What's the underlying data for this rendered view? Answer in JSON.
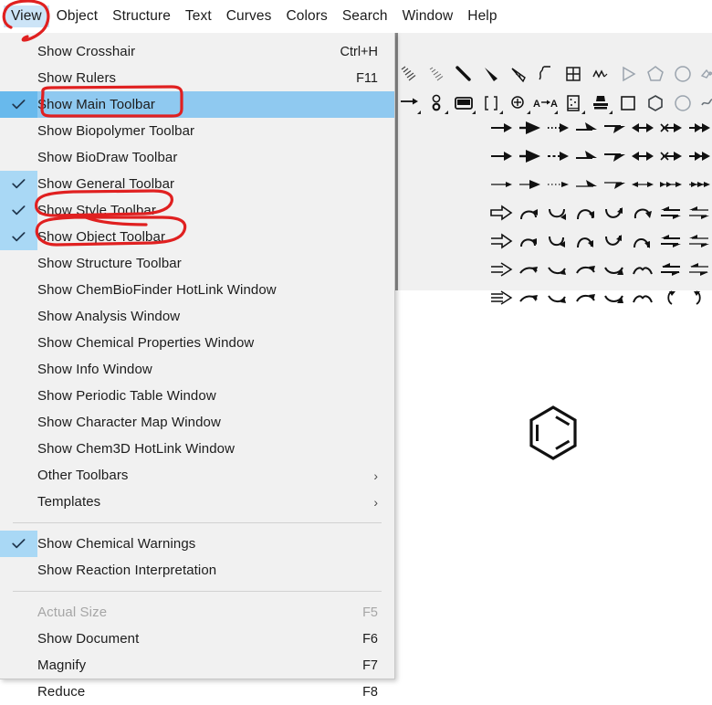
{
  "menubar": {
    "items": [
      {
        "label": "View",
        "active": true
      },
      {
        "label": "Object",
        "active": false
      },
      {
        "label": "Structure",
        "active": false
      },
      {
        "label": "Text",
        "active": false
      },
      {
        "label": "Curves",
        "active": false
      },
      {
        "label": "Colors",
        "active": false
      },
      {
        "label": "Search",
        "active": false
      },
      {
        "label": "Window",
        "active": false
      },
      {
        "label": "Help",
        "active": false
      }
    ]
  },
  "view_menu": {
    "items": [
      {
        "label": "Show Crosshair",
        "accel": "Ctrl+H",
        "checked": false,
        "highlighted": false,
        "disabled": false,
        "submenu": false
      },
      {
        "label": "Show Rulers",
        "accel": "F11",
        "checked": false,
        "highlighted": false,
        "disabled": false,
        "submenu": false
      },
      {
        "label": "Show Main Toolbar",
        "accel": "",
        "checked": true,
        "highlighted": true,
        "disabled": false,
        "submenu": false
      },
      {
        "label": "Show Biopolymer Toolbar",
        "accel": "",
        "checked": false,
        "highlighted": false,
        "disabled": false,
        "submenu": false
      },
      {
        "label": "Show BioDraw Toolbar",
        "accel": "",
        "checked": false,
        "highlighted": false,
        "disabled": false,
        "submenu": false
      },
      {
        "label": "Show General Toolbar",
        "accel": "",
        "checked": true,
        "highlighted": false,
        "disabled": false,
        "submenu": false
      },
      {
        "label": "Show Style Toolbar",
        "accel": "",
        "checked": true,
        "highlighted": false,
        "disabled": false,
        "submenu": false
      },
      {
        "label": "Show Object Toolbar",
        "accel": "",
        "checked": true,
        "highlighted": false,
        "disabled": false,
        "submenu": false
      },
      {
        "label": "Show Structure Toolbar",
        "accel": "",
        "checked": false,
        "highlighted": false,
        "disabled": false,
        "submenu": false
      },
      {
        "label": "Show ChemBioFinder HotLink Window",
        "accel": "",
        "checked": false,
        "highlighted": false,
        "disabled": false,
        "submenu": false
      },
      {
        "label": "Show Analysis Window",
        "accel": "",
        "checked": false,
        "highlighted": false,
        "disabled": false,
        "submenu": false
      },
      {
        "label": "Show Chemical Properties Window",
        "accel": "",
        "checked": false,
        "highlighted": false,
        "disabled": false,
        "submenu": false
      },
      {
        "label": "Show Info Window",
        "accel": "",
        "checked": false,
        "highlighted": false,
        "disabled": false,
        "submenu": false
      },
      {
        "label": "Show Periodic Table Window",
        "accel": "",
        "checked": false,
        "highlighted": false,
        "disabled": false,
        "submenu": false
      },
      {
        "label": "Show Character Map Window",
        "accel": "",
        "checked": false,
        "highlighted": false,
        "disabled": false,
        "submenu": false
      },
      {
        "label": "Show Chem3D HotLink Window",
        "accel": "",
        "checked": false,
        "highlighted": false,
        "disabled": false,
        "submenu": false
      },
      {
        "label": "Other Toolbars",
        "accel": "",
        "checked": false,
        "highlighted": false,
        "disabled": false,
        "submenu": true
      },
      {
        "label": "Templates",
        "accel": "",
        "checked": false,
        "highlighted": false,
        "disabled": false,
        "submenu": true
      },
      {
        "separator": true
      },
      {
        "label": "Show Chemical Warnings",
        "accel": "",
        "checked": true,
        "highlighted": false,
        "disabled": false,
        "submenu": false
      },
      {
        "label": "Show Reaction Interpretation",
        "accel": "",
        "checked": false,
        "highlighted": false,
        "disabled": false,
        "submenu": false
      },
      {
        "separator": true
      },
      {
        "label": "Actual Size",
        "accel": "F5",
        "checked": false,
        "highlighted": false,
        "disabled": true,
        "submenu": false
      },
      {
        "label": "Show Document",
        "accel": "F6",
        "checked": false,
        "highlighted": false,
        "disabled": false,
        "submenu": false
      },
      {
        "label": "Magnify",
        "accel": "F7",
        "checked": false,
        "highlighted": false,
        "disabled": false,
        "submenu": false
      },
      {
        "label": "Reduce",
        "accel": "F8",
        "checked": false,
        "highlighted": false,
        "disabled": false,
        "submenu": false
      }
    ],
    "submenu_glyph": "›",
    "checkmark_glyph": "✓"
  },
  "toolbar": {
    "row_main": [
      {
        "icon": "hash-lines-icon",
        "selected": false,
        "corner": false
      },
      {
        "icon": "hash-lines-thin-icon",
        "selected": false,
        "corner": false
      },
      {
        "icon": "bold-bond-icon",
        "selected": false,
        "corner": false
      },
      {
        "icon": "wedge-bond-icon",
        "selected": false,
        "corner": false
      },
      {
        "icon": "hashed-wedge-bond-icon",
        "selected": false,
        "corner": false
      },
      {
        "icon": "squiggle-bond-icon",
        "selected": false,
        "corner": false
      },
      {
        "icon": "table-grid-icon",
        "selected": false,
        "corner": false
      },
      {
        "icon": "chain-icon",
        "selected": false,
        "corner": false
      },
      {
        "icon": "triangle-outline-icon",
        "selected": false,
        "corner": false
      },
      {
        "icon": "pentagon-outline-icon",
        "selected": false,
        "corner": false
      },
      {
        "icon": "circle-outline-icon",
        "selected": false,
        "corner": false
      },
      {
        "icon": "zigzag-ribbon-icon",
        "selected": false,
        "corner": false
      },
      {
        "icon": "home-pentagon-icon",
        "selected": false,
        "corner": false
      }
    ],
    "row_object": [
      {
        "icon": "arrow-tool-icon",
        "selected": false,
        "corner": true
      },
      {
        "icon": "orbital-tool-icon",
        "selected": false,
        "corner": true
      },
      {
        "icon": "drawing-frame-icon",
        "selected": false,
        "corner": true
      },
      {
        "icon": "brackets-icon",
        "selected": false,
        "corner": true
      },
      {
        "icon": "charge-circle-icon",
        "selected": false,
        "corner": true
      },
      {
        "icon": "atom-label-icon",
        "selected": false,
        "corner": true
      },
      {
        "icon": "tlc-plate-icon",
        "selected": false,
        "corner": true
      },
      {
        "icon": "stamp-tool-icon",
        "selected": false,
        "corner": true
      },
      {
        "icon": "square-outline-icon",
        "selected": false,
        "corner": false
      },
      {
        "icon": "hexagon-outline-icon",
        "selected": false,
        "corner": false
      },
      {
        "icon": "circle-ring-icon",
        "selected": false,
        "corner": false
      },
      {
        "icon": "wave-icon",
        "selected": false,
        "corner": false
      },
      {
        "icon": "benzene-ring-tool-icon",
        "selected": true,
        "corner": false
      }
    ],
    "arrow_palette": {
      "rows": 7,
      "cols": 8,
      "cells": [
        [
          "arrow-solid-icon",
          "arrow-wide-head-icon",
          "arrow-dotted-icon",
          "arrow-half-head-up-icon",
          "arrow-half-head-down-icon",
          "arrow-double-head-icon",
          "arrow-crossed-icon",
          "arrow-double-barb-icon"
        ],
        [
          "arrow-solid-icon",
          "arrow-wide-head-icon",
          "arrow-dashed-icon",
          "arrow-half-head-up-icon",
          "arrow-half-head-down-icon",
          "arrow-double-head-icon",
          "arrow-crossed-icon",
          "arrow-double-barb-icon"
        ],
        [
          "arrow-thin-icon",
          "arrow-thin-wide-icon",
          "arrow-thin-dotted-icon",
          "arrow-thin-half-up-icon",
          "arrow-thin-half-down-icon",
          "arrow-thin-double-icon",
          "arrow-thin-crossed-icon",
          "arrow-thin-barb-icon"
        ],
        [
          "block-arrow-hollow-icon",
          "curve-arrow-cw-icon",
          "curve-arrow-ccw-icon",
          "curve-arrow-arc-cw-icon",
          "curve-arrow-arc-ccw-icon",
          "curve-arrow-loop-icon",
          "equilibrium-arrow-icon",
          "equilibrium-thin-icon"
        ],
        [
          "block-arrow-open-icon",
          "curve-arrow-up-cw-icon",
          "curve-arrow-up-ccw-icon",
          "curve-arrow-u-cw-icon",
          "curve-arrow-u-ccw-icon",
          "curve-arrow-n-icon",
          "equilibrium-arrow-icon",
          "equilibrium-thin-icon"
        ],
        [
          "block-arrow-line-icon",
          "hook-arrow-right-icon",
          "hook-arrow-down-icon",
          "hook-arrow-arc-icon",
          "hook-arrow-arc-down-icon",
          "hook-arrow-bridge-icon",
          "equilibrium-half-icon",
          "equilibrium-half-thin-icon"
        ],
        [
          "block-arrow-double-icon",
          "hook-arrow-right-icon",
          "hook-arrow-down-icon",
          "hook-arrow-arc-icon",
          "hook-arrow-arc-down-icon",
          "hook-arrow-bridge-icon",
          "retro-arrow-left-icon",
          "retro-arrow-right-icon"
        ]
      ]
    }
  },
  "canvas": {
    "objects": [
      {
        "name": "benzene-ring",
        "type": "structure"
      }
    ]
  },
  "annotations": {
    "color": "#e02020",
    "marks": [
      {
        "name": "circle-view-menu",
        "shape": "ellipse"
      },
      {
        "name": "box-show-main-toolbar",
        "shape": "rounded-rect"
      },
      {
        "name": "oval-show-style-toolbar",
        "shape": "ellipse"
      },
      {
        "name": "oval-show-object-toolbar",
        "shape": "ellipse"
      }
    ]
  }
}
